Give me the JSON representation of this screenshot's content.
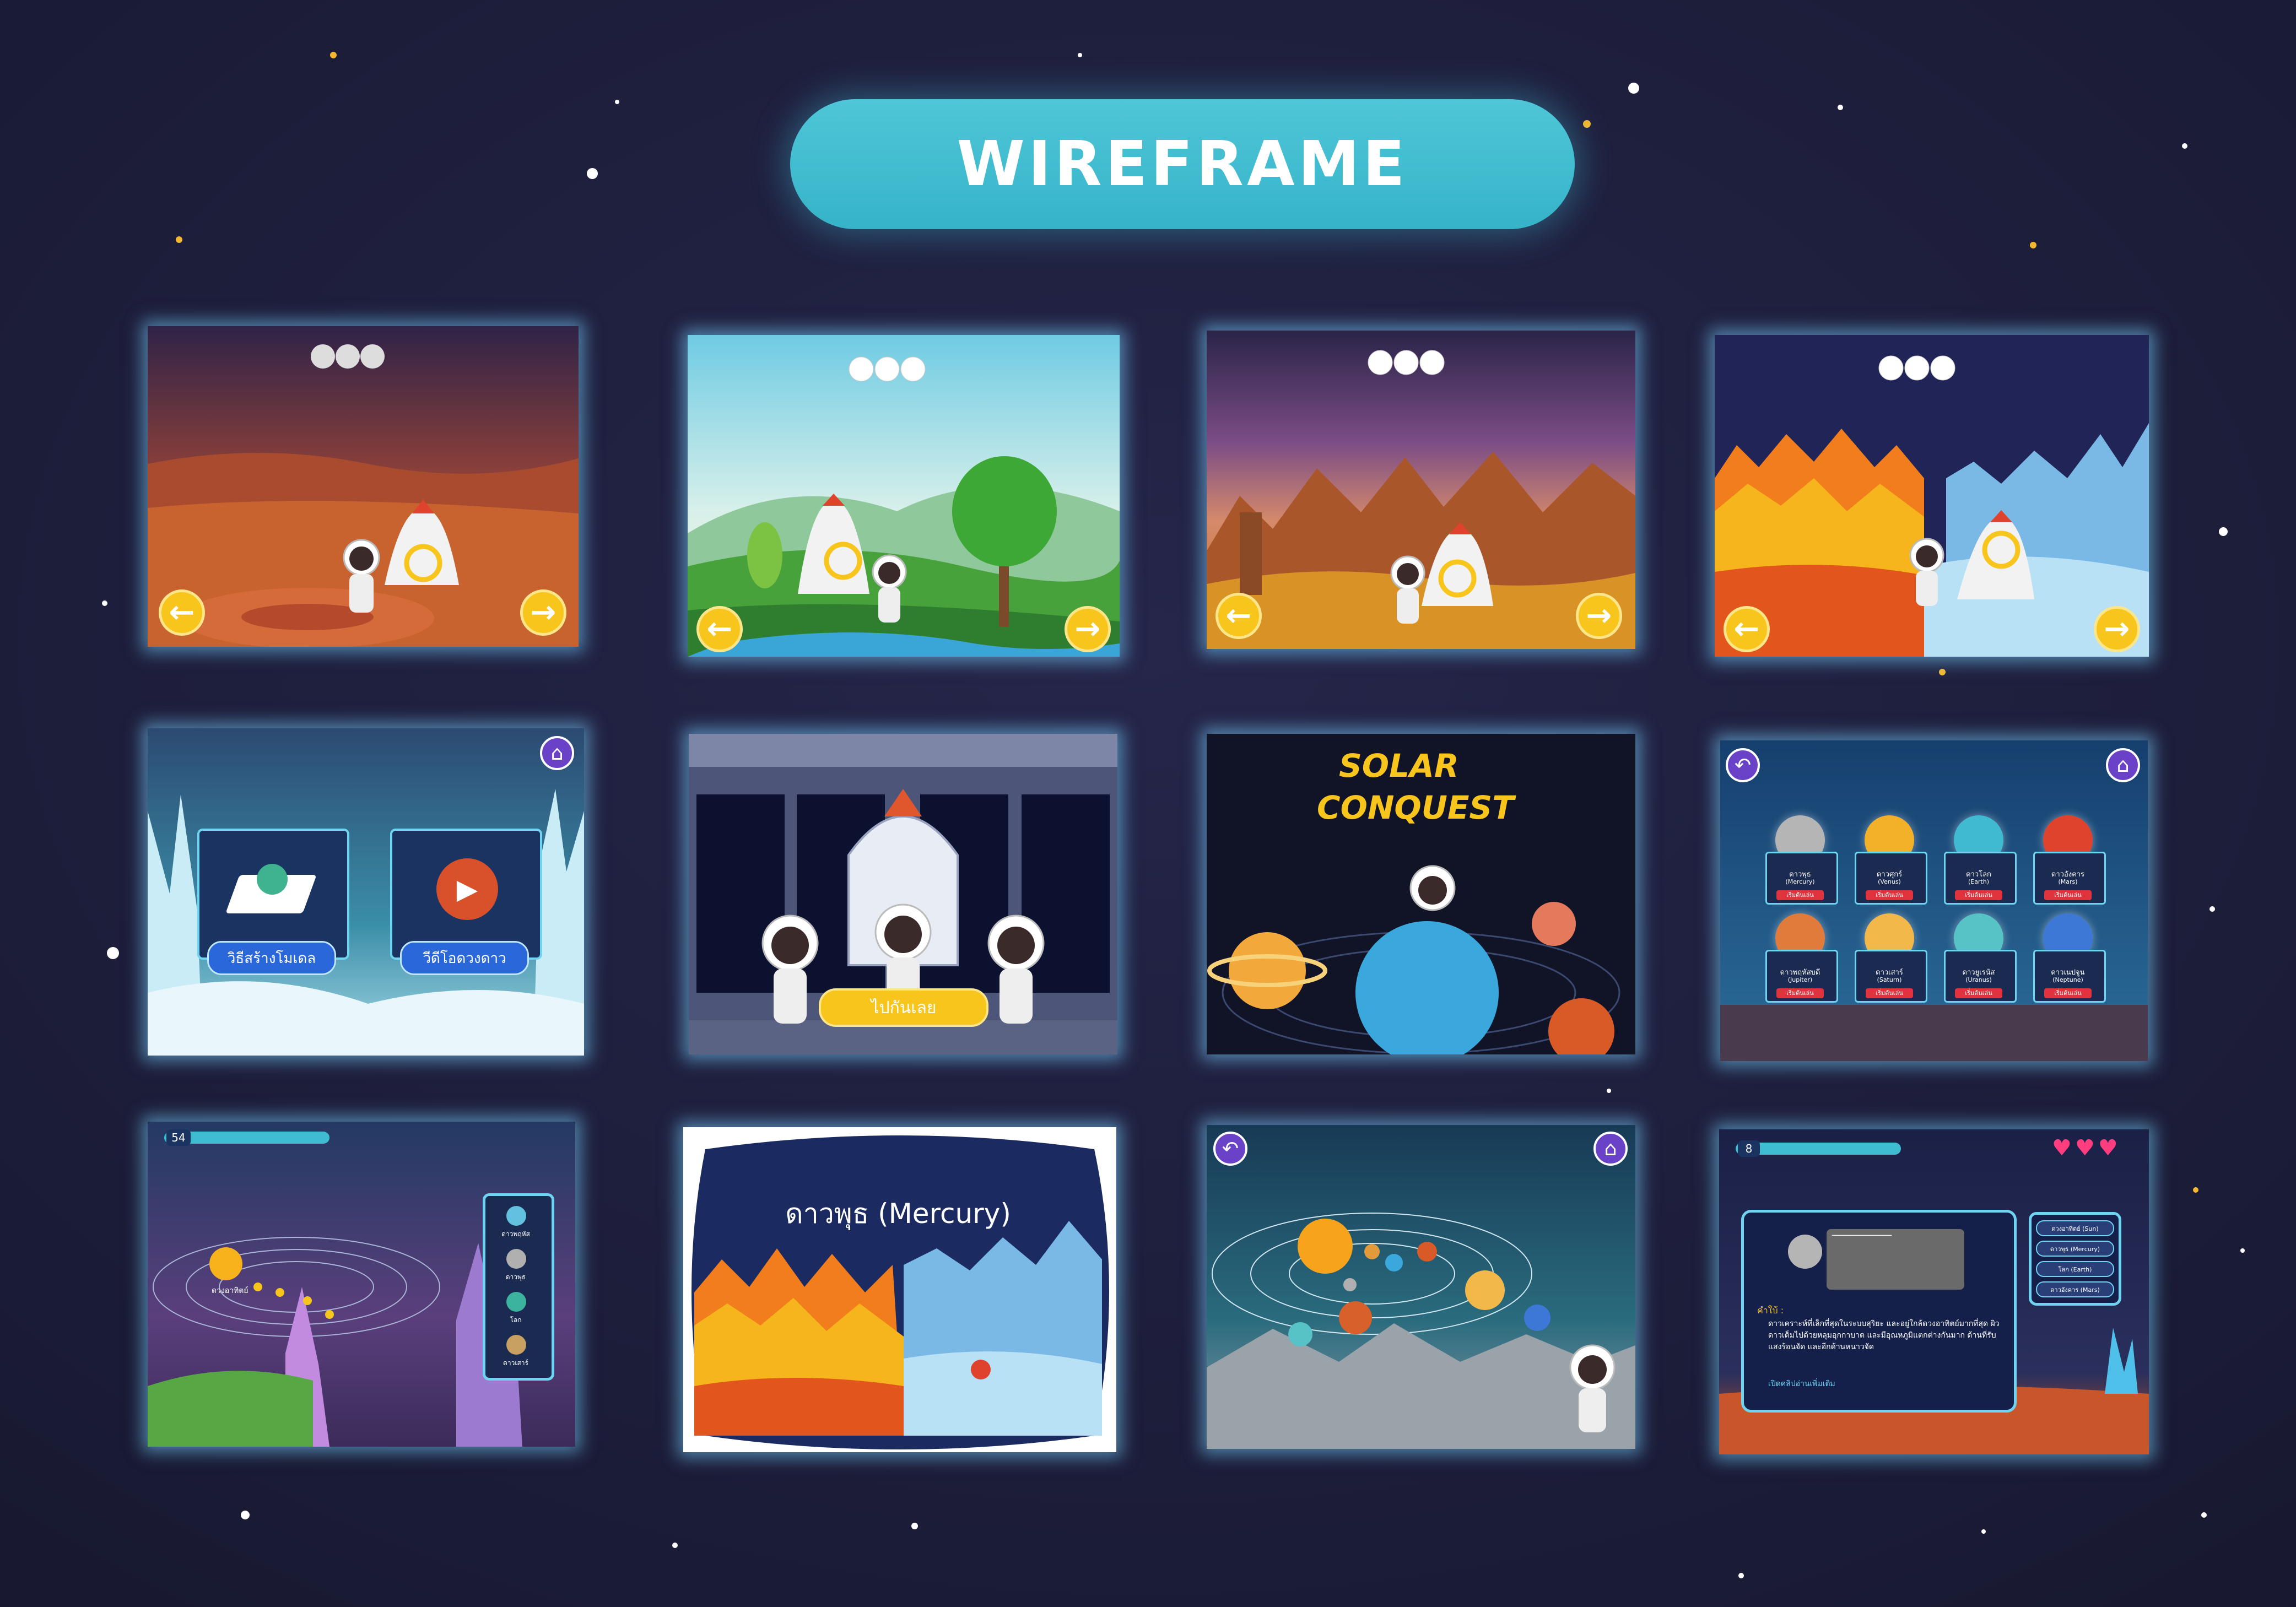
{
  "page_title": "WIREFRAME",
  "colors": {
    "background": "#1c1d3a",
    "title_pill": "#3fbccf",
    "accent_yellow": "#f7c51c",
    "accent_purple": "#6a42c8",
    "panel_glow": "#78d2ff"
  },
  "icons": {
    "prev": "arrow-left-icon",
    "next": "arrow-right-icon",
    "home": "home-icon",
    "back": "back-icon",
    "heart": "heart-icon",
    "play": "play-icon"
  },
  "glyphs": {
    "left": "←",
    "right": "→",
    "home": "⌂",
    "back": "↶",
    "play": "▶",
    "heart": "♥"
  },
  "screens": {
    "s1": {
      "kind": "mars-surface"
    },
    "s2": {
      "kind": "earth-landscape"
    },
    "s3": {
      "kind": "venus-canyon"
    },
    "s4": {
      "kind": "mercury-fire-ice"
    },
    "s5": {
      "button_ar": "วิธีสร้างโมเดล",
      "button_video": "วีดีโอดวงดาว"
    },
    "s6": {
      "go_button": "ไปกันเลย"
    },
    "s7": {
      "logo_line1": "SOLAR",
      "logo_line2": "CONQUEST"
    },
    "s8": {
      "planets": [
        {
          "name": "ดาวพุธ",
          "en": "(Mercury)",
          "btn": "เริ่มต้นเล่น",
          "color": "#b5b5b5"
        },
        {
          "name": "ดาวศุกร์",
          "en": "(Venus)",
          "btn": "เริ่มต้นเล่น",
          "color": "#f3b12a"
        },
        {
          "name": "ดาวโลก",
          "en": "(Earth)",
          "btn": "เริ่มต้นเล่น",
          "color": "#3fbad0"
        },
        {
          "name": "ดาวอังคาร",
          "en": "(Mars)",
          "btn": "เริ่มต้นเล่น",
          "color": "#e0432d"
        },
        {
          "name": "ดาวพฤหัสบดี",
          "en": "(Jupiter)",
          "btn": "เริ่มต้นเล่น",
          "color": "#e07b3b"
        },
        {
          "name": "ดาวเสาร์",
          "en": "(Saturn)",
          "btn": "เริ่มต้นเล่น",
          "color": "#f2b84a"
        },
        {
          "name": "ดาวยูเรนัส",
          "en": "(Uranus)",
          "btn": "เริ่มต้นเล่น",
          "color": "#57c3c6"
        },
        {
          "name": "ดาวเนปจูน",
          "en": "(Neptune)",
          "btn": "เริ่มต้นเล่น",
          "color": "#3d78d6"
        }
      ]
    },
    "s9": {
      "score": "54",
      "sun_label": "ดวงอาทิตย์",
      "sidebar": [
        {
          "label": "ดาวพฤหัส",
          "color": "#63c1e0"
        },
        {
          "label": "ดาวพุธ",
          "color": "#b0b0b0"
        },
        {
          "label": "โลก",
          "color": "#3bb39e"
        },
        {
          "label": "ดาวเสาร์",
          "color": "#c8a061"
        }
      ]
    },
    "s10": {
      "heading": "ดาวพุธ (Mercury)"
    },
    "s11": {
      "kind": "solar-system-view"
    },
    "s12": {
      "score": "8",
      "lives": 3,
      "blank": "____________",
      "label_prefix": "คำใบ้ :",
      "desc": "ดาวเคราะห์ที่เล็กที่สุดในระบบสุริยะ และอยู่ใกล้ดวงอาทิตย์มากที่สุด ผิวดาวเต็มไปด้วยหลุมอุกกาบาต และมีอุณหภูมิแตกต่างกันมาก ด้านที่รับแสงร้อนจัด และอีกด้านหนาวจัด",
      "link": "เปิดคลิปอ่านเพิ่มเติม",
      "options": [
        "ดวงอาทิตย์ (Sun)",
        "ดาวพุธ (Mercury)",
        "โลก (Earth)",
        "ดาวอังคาร (Mars)"
      ]
    }
  }
}
